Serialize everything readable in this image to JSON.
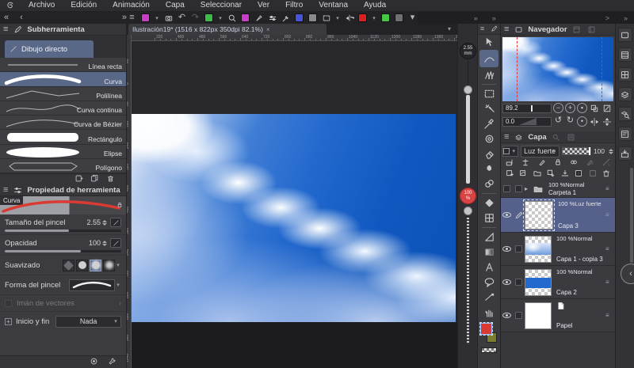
{
  "menu_bar": {
    "items": [
      "Archivo",
      "Edición",
      "Animación",
      "Capa",
      "Seleccionar",
      "Ver",
      "Filtro",
      "Ventana",
      "Ayuda"
    ]
  },
  "command_bar": {
    "icons": [
      {
        "name": "main-menu",
        "kind": "glyph",
        "glyph": "≡"
      },
      {
        "name": "canvas-display-color",
        "kind": "tile",
        "color": "#c63ec6",
        "chevron": true
      },
      {
        "name": "screen-capture",
        "kind": "svg"
      },
      {
        "name": "undo",
        "kind": "glyph",
        "glyph": "↶"
      },
      {
        "name": "redo",
        "kind": "glyph",
        "glyph": "↷",
        "disabled": true
      },
      {
        "name": "snap-ruler",
        "kind": "tile",
        "color": "#3dbb4a",
        "chevron": true
      },
      {
        "name": "zoom-lens",
        "kind": "svg"
      },
      {
        "name": "pen-pressure",
        "kind": "tile",
        "color": "#c63ec6"
      },
      {
        "name": "pen-nib",
        "kind": "svg"
      },
      {
        "name": "adjust-sliders",
        "kind": "svg"
      },
      {
        "name": "eyedropper",
        "kind": "svg"
      },
      {
        "name": "antialias-ring",
        "kind": "tile",
        "color": "#4554d8"
      },
      {
        "name": "transparent-checker",
        "kind": "tile",
        "color": "#8a8a8e"
      },
      {
        "name": "selection-area",
        "kind": "svg",
        "chevron": true
      },
      {
        "name": "flip-horizontal",
        "kind": "svg"
      },
      {
        "name": "timeline-red",
        "kind": "tile",
        "color": "#d82222",
        "chevron": true
      },
      {
        "name": "onion-skin",
        "kind": "tile",
        "color": "#46c846"
      },
      {
        "name": "export-save",
        "kind": "tile",
        "color": "#6e6e73"
      },
      {
        "name": "more-commands",
        "kind": "glyph",
        "glyph": "▾"
      }
    ],
    "left_markers": [
      "«",
      "‹",
      "»"
    ],
    "right_markers": [
      "»",
      "»",
      ">",
      "»"
    ]
  },
  "subtool_panel": {
    "title": "Subherramienta",
    "group_tab": "Dibujo directo",
    "items": [
      {
        "label": "Línea recta",
        "shape": "line",
        "selected": false
      },
      {
        "label": "Curva",
        "shape": "thick-curve",
        "selected": true
      },
      {
        "label": "Polilínea",
        "shape": "polyline",
        "selected": false
      },
      {
        "label": "Curva continua",
        "shape": "wave",
        "selected": false
      },
      {
        "label": "Curva de Bézier",
        "shape": "bezier",
        "selected": false
      },
      {
        "label": "Rectángulo",
        "shape": "rect",
        "selected": false
      },
      {
        "label": "Elipse",
        "shape": "ellipse",
        "selected": false
      },
      {
        "label": "Polígono",
        "shape": "polygon",
        "selected": false
      }
    ]
  },
  "tool_property_panel": {
    "title": "Propiedad de herramienta",
    "tool_name": "Curva",
    "brush_size_label": "Tamaño del pincel",
    "brush_size_value": "2.55",
    "brush_size_fill_pct": 55,
    "opacity_label": "Opacidad",
    "opacity_value": "100",
    "opacity_fill_pct": 65,
    "smoothing_label": "Suavizado",
    "brush_shape_label": "Forma del pincel",
    "vector_magnet_label": "Imán de vectores",
    "start_end_label": "Inicio y fin",
    "start_end_value": "Nada"
  },
  "canvas": {
    "tab_title": "Ilustración19* (1516 x 822px 350dpi 82.1%)",
    "h_ruler_values": [
      320,
      400,
      480,
      560,
      640,
      720,
      800,
      880,
      960,
      1040,
      1120,
      1200,
      1280,
      1360,
      1440
    ],
    "v_ruler_values": [
      80,
      0,
      80,
      160,
      240,
      320,
      400,
      480,
      560,
      640,
      720,
      800,
      880,
      960,
      1040
    ]
  },
  "size_slider": {
    "value": "2.55",
    "unit": "mm"
  },
  "zoom_badge": {
    "value": "100",
    "unit": "%"
  },
  "navigator": {
    "title": "Navegador",
    "zoom_value": "89.2",
    "rotation_value": "0.0"
  },
  "layers_panel": {
    "title": "Capa",
    "blend_mode": "Luz fuerte",
    "opacity_value": "100",
    "layers": [
      {
        "mode": "100 %Normal",
        "name": "Carpeta 1",
        "type": "folder",
        "selected": false
      },
      {
        "mode": "100 %Luz fuerte",
        "name": "Capa 3",
        "type": "layer",
        "thumb": "checker",
        "selected": true,
        "editing": true
      },
      {
        "mode": "100 %Normal",
        "name": "Capa 1 - copia 3",
        "type": "layer",
        "thumb": "clouds",
        "selected": false
      },
      {
        "mode": "100 %Normal",
        "name": "Capa 2",
        "type": "layer",
        "thumb": "blueband",
        "selected": false
      },
      {
        "mode": "",
        "name": "Papel",
        "type": "paper",
        "thumb": "white",
        "selected": false
      }
    ]
  },
  "tool_strip": {
    "tools": [
      "object",
      "curve",
      "decoration",
      "divider",
      "marquee",
      "auto-select",
      "eyedropper",
      "move",
      "eraser",
      "blend",
      "mix",
      "divider",
      "fill",
      "frame",
      "divider",
      "ruler",
      "gradient",
      "text",
      "balloon",
      "line",
      "hand"
    ],
    "selected_tool": "curve"
  },
  "right_strip": {
    "icons": [
      "navigator",
      "subview",
      "information",
      "layers",
      "layer-search",
      "layer-property",
      "material"
    ]
  },
  "colors": {
    "selection_accent": "#5a6888",
    "foreground_swatch": "#d93a32",
    "background_swatch": "#7a7d2e",
    "deep_sky": "#0b51b6",
    "badge_red": "#d84343"
  }
}
